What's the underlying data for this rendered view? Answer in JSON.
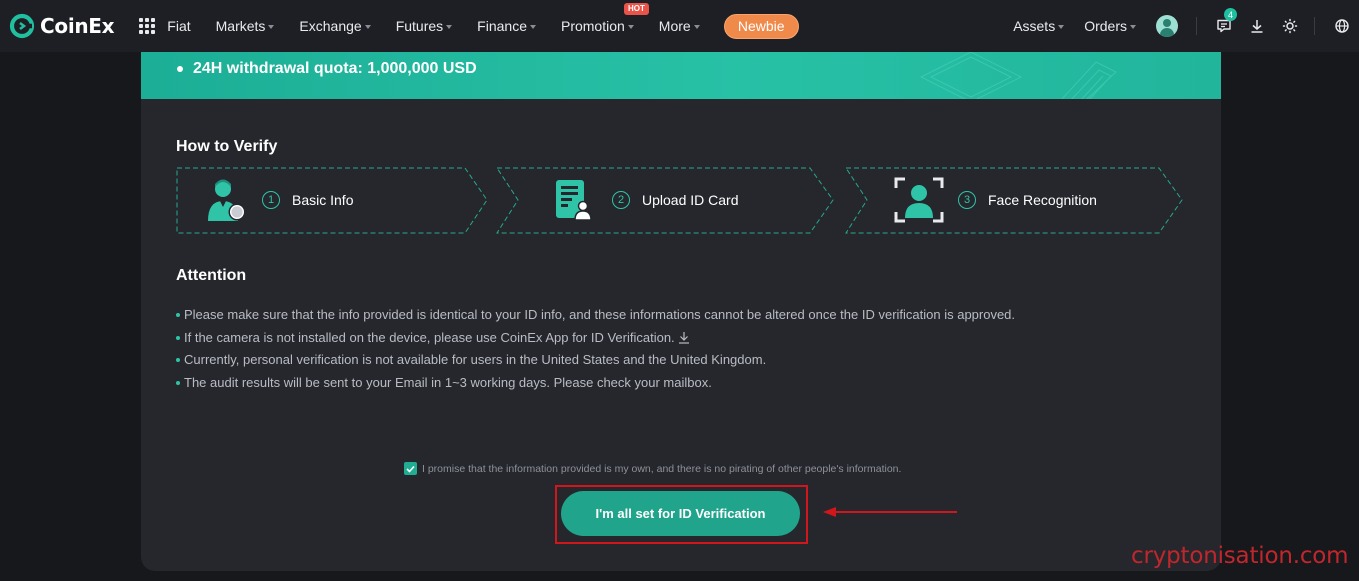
{
  "nav": {
    "brand": "CoinEx",
    "items": [
      {
        "label": "Fiat",
        "caret": false
      },
      {
        "label": "Markets",
        "caret": true
      },
      {
        "label": "Exchange",
        "caret": true
      },
      {
        "label": "Futures",
        "caret": true
      },
      {
        "label": "Finance",
        "caret": true
      },
      {
        "label": "Promotion",
        "caret": true,
        "badge": "HOT"
      },
      {
        "label": "More",
        "caret": true
      }
    ],
    "newbie": "Newbie",
    "right": {
      "assets": "Assets",
      "orders": "Orders",
      "notification_count": "4"
    },
    "accent": "#1fbf9f"
  },
  "banner": {
    "quota_text": "24H withdrawal quota: 1,000,000 USD"
  },
  "how_to_verify": {
    "title": "How to Verify",
    "steps": [
      {
        "num": "1",
        "label": "Basic Info",
        "icon": "user-info-icon"
      },
      {
        "num": "2",
        "label": "Upload ID Card",
        "icon": "id-card-icon"
      },
      {
        "num": "3",
        "label": "Face Recognition",
        "icon": "face-scan-icon"
      }
    ]
  },
  "attention": {
    "title": "Attention",
    "items": [
      "Please make sure that the info provided is identical to your ID info, and these informations cannot be altered once the ID verification is approved.",
      "If the camera is not installed on the device, please use CoinEx App for ID Verification.",
      "Currently, personal verification is not available for users in the United States and the United Kingdom.",
      "The audit results will be sent to your Email in 1~3 working days. Please check your mailbox."
    ]
  },
  "promise": {
    "checked": true,
    "text": "I promise that the information provided is my own, and there is no pirating of other people's information."
  },
  "verify_button": "I'm all set for ID Verification",
  "watermark": "cryptonisation.com"
}
